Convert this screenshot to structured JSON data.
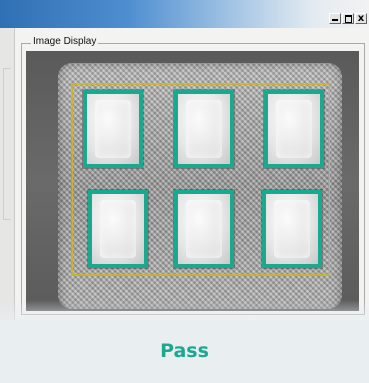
{
  "window": {
    "controls": {
      "minimize_icon": "minimize-icon",
      "maximize_icon": "maximize-icon",
      "close_glyph": "x"
    }
  },
  "image_display": {
    "title": "Image Display",
    "pockets_rows": 2,
    "pockets_per_row": 3
  },
  "result": {
    "label": "Pass",
    "color": "#1aa88f"
  },
  "colors": {
    "detection_box": "#1aa88f",
    "roi_outline": "#c8b23a"
  }
}
